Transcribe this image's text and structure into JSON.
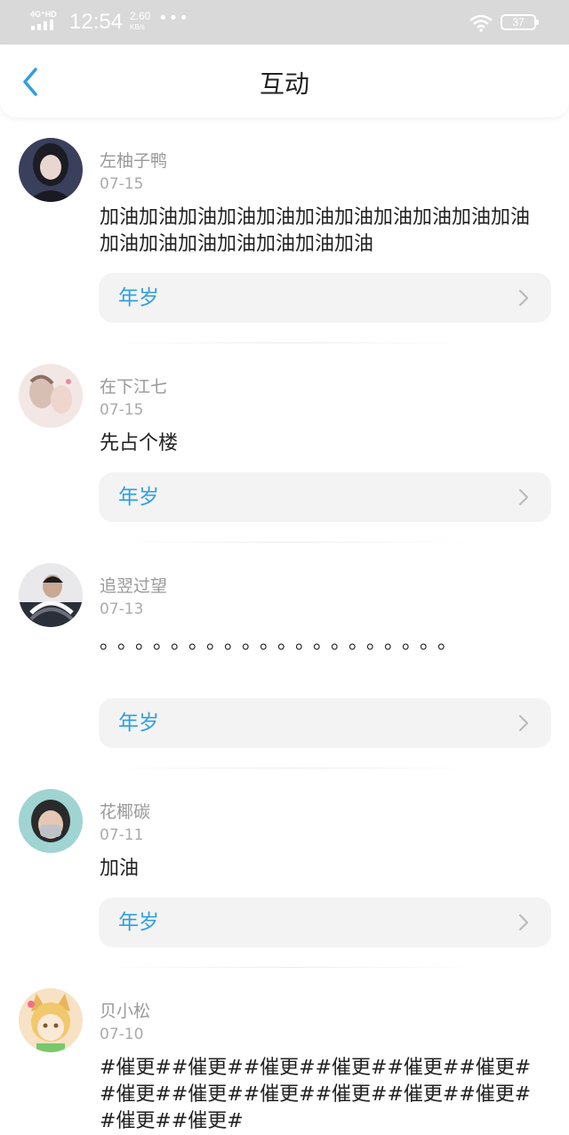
{
  "status_bar": {
    "network": "4G⁺HD",
    "time": "12:54",
    "speed": "2.60",
    "speed_unit": "KB/s",
    "more": "•••",
    "battery": "37"
  },
  "header": {
    "title": "互动",
    "accent_color": "#2e9fe0"
  },
  "posts": [
    {
      "username": "左柚子鸭",
      "date": "07-15",
      "content": "加油加油加油加油加油加油加油加油加油加油加油加油加油加油加油加油加油加油",
      "link_label": "年岁",
      "avatar": "dark-hair-girl-avatar"
    },
    {
      "username": "在下江七",
      "date": "07-15",
      "content": "先占个楼",
      "link_label": "年岁",
      "avatar": "illustrated-couple-avatar"
    },
    {
      "username": "追翌过望",
      "date": "07-13",
      "content": "。。。。。。。。。。。。。。。。。。。。",
      "link_label": "年岁",
      "avatar": "person-striped-sweater-avatar"
    },
    {
      "username": "花椰碳",
      "date": "07-11",
      "content": "加油",
      "link_label": "年岁",
      "avatar": "masked-person-avatar"
    },
    {
      "username": "贝小松",
      "date": "07-10",
      "content": "#催更##催更##催更##催更##催更##催更##催更##催更##催更##催更##催更##催更##催更##催更#",
      "link_label": "",
      "avatar": "cartoon-cat-girl-avatar"
    }
  ]
}
